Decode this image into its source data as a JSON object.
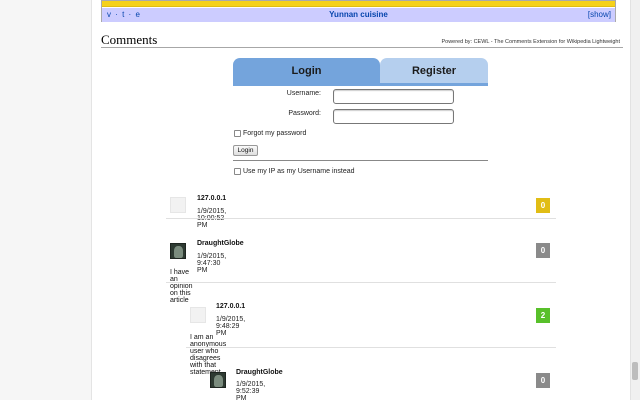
{
  "navbox": {
    "vte": "v · t · e",
    "title": "Yunnan cuisine",
    "show": "[show]"
  },
  "section": {
    "heading": "Comments",
    "powered_by": "Powered by: CEWL - The Comments Extension for Wikipedia Lightweight"
  },
  "auth": {
    "tabs": {
      "login": "Login",
      "register": "Register"
    },
    "username_label": "Username:",
    "password_label": "Password:",
    "forgot_label": "Forgot my password",
    "login_button": "Login",
    "use_ip_label": "Use my IP as my Username instead"
  },
  "comments": [
    {
      "author": "127.0.0.1",
      "timestamp": "1/9/2015, 10:00:52 PM",
      "text": "",
      "score": "0",
      "score_color": "#e1bd15",
      "avatar": "blank"
    },
    {
      "author": "DraughtGlobe",
      "timestamp": "1/9/2015, 9:47:30 PM",
      "text": "I have an opinion on this article",
      "score": "0",
      "score_color": "#8a8a8a",
      "avatar": "image"
    },
    {
      "author": "127.0.0.1",
      "timestamp": "1/9/2015, 9:48:29 PM",
      "text": "I am an anonymous user who disagrees with that statement",
      "score": "2",
      "score_color": "#58c02a",
      "avatar": "blank"
    },
    {
      "author": "DraughtGlobe",
      "timestamp": "1/9/2015, 9:52:39 PM",
      "text": "",
      "score": "0",
      "score_color": "#8a8a8a",
      "avatar": "image"
    }
  ]
}
